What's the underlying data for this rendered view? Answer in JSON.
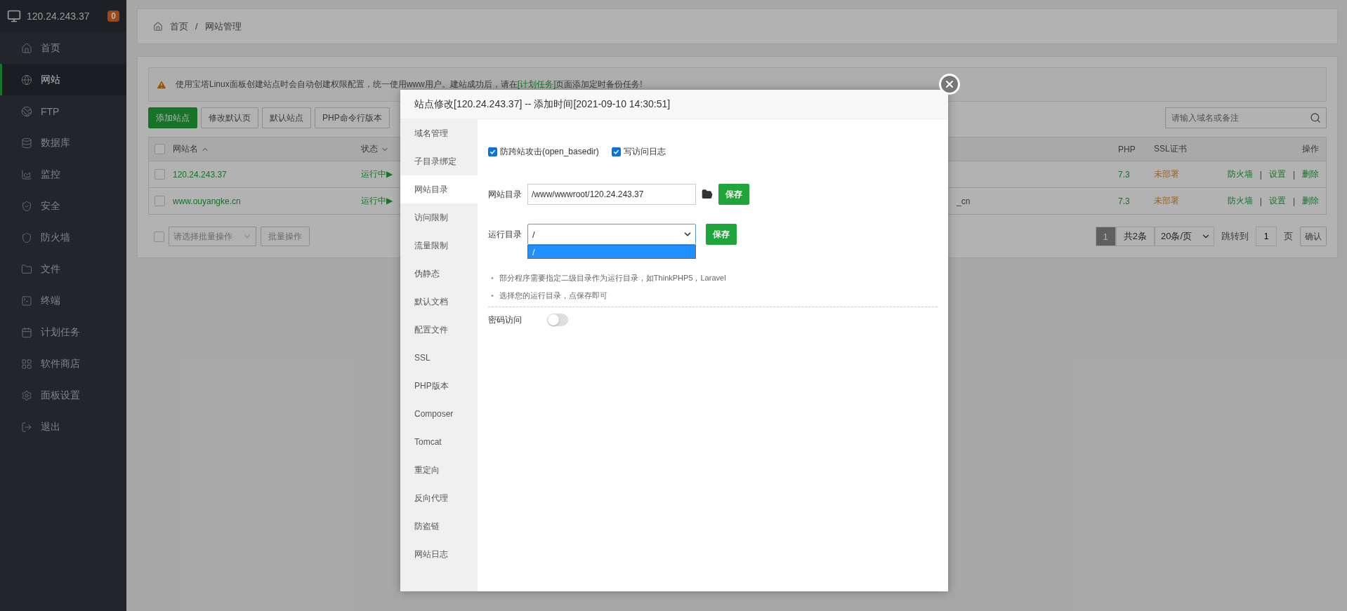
{
  "sidebar": {
    "host": "120.24.243.37",
    "badge": "0",
    "items": [
      {
        "kind": "home",
        "label": "首页",
        "selected": false
      },
      {
        "kind": "globe",
        "label": "网站",
        "selected": true
      },
      {
        "kind": "ftp",
        "label": "FTP",
        "selected": false
      },
      {
        "kind": "database",
        "label": "数据库",
        "selected": false
      },
      {
        "kind": "monitor",
        "label": "监控",
        "selected": false
      },
      {
        "kind": "security",
        "label": "安全",
        "selected": false
      },
      {
        "kind": "firewall",
        "label": "防火墙",
        "selected": false
      },
      {
        "kind": "files",
        "label": "文件",
        "selected": false
      },
      {
        "kind": "terminal",
        "label": "终端",
        "selected": false
      },
      {
        "kind": "calendar",
        "label": "计划任务",
        "selected": false
      },
      {
        "kind": "store",
        "label": "软件商店",
        "selected": false
      },
      {
        "kind": "settings",
        "label": "面板设置",
        "selected": false
      },
      {
        "kind": "logout",
        "label": "退出",
        "selected": false
      }
    ]
  },
  "breadcrumb": {
    "items": [
      "首页",
      "网站管理"
    ],
    "separator": "/"
  },
  "notice": {
    "before": "使用宝塔Linux面板创建站点时会自动创建权限配置，统一使用www用户。建站成功后，请在",
    "link": "[计划任务]",
    "after": "页面添加定时备份任务!"
  },
  "toolbar": {
    "buttons": [
      {
        "label": "添加站点",
        "primary": true
      },
      {
        "label": "修改默认页",
        "primary": false
      },
      {
        "label": "默认站点",
        "primary": false
      },
      {
        "label": "PHP命令行版本",
        "primary": false
      }
    ],
    "search": {
      "placeholder": "请输入域名或备注"
    }
  },
  "table": {
    "select_all": {
      "checked": false
    },
    "columns": [
      "网站名",
      "状态",
      "PHP",
      "SSL证书",
      "操作"
    ],
    "rows": [
      {
        "checked": false,
        "name": "120.24.243.37",
        "status": "运行中▶",
        "php": "7.3",
        "ssl": "未部署",
        "actions": [
          "防火墙",
          "设置",
          "删除"
        ],
        "separator": "|"
      },
      {
        "checked": false,
        "name": "www.ouyangke.cn",
        "status": "运行中▶",
        "note": "_cn",
        "php": "7.3",
        "ssl": "未部署",
        "actions": [
          "防火墙",
          "设置",
          "删除"
        ],
        "separator": "|"
      }
    ]
  },
  "batch": {
    "checked": false,
    "placeholder": "请选择批量操作",
    "button": "批量操作"
  },
  "pagination": {
    "current": "1",
    "total": "共2条",
    "per_page": "20条/页",
    "jump_label": "跳转到",
    "jump_value": "1",
    "page_unit": "页",
    "confirm": "确认"
  },
  "modal": {
    "title": "站点修改[120.24.243.37] -- 添加时间[2021-09-10 14:30:51]",
    "menu": [
      {
        "label": "域名管理",
        "selected": false
      },
      {
        "label": "子目录绑定",
        "selected": false
      },
      {
        "label": "网站目录",
        "selected": true
      },
      {
        "label": "访问限制",
        "selected": false
      },
      {
        "label": "流量限制",
        "selected": false
      },
      {
        "label": "伪静态",
        "selected": false
      },
      {
        "label": "默认文档",
        "selected": false
      },
      {
        "label": "配置文件",
        "selected": false
      },
      {
        "label": "SSL",
        "selected": false
      },
      {
        "label": "PHP版本",
        "selected": false
      },
      {
        "label": "Composer",
        "selected": false
      },
      {
        "label": "Tomcat",
        "selected": false
      },
      {
        "label": "重定向",
        "selected": false
      },
      {
        "label": "反向代理",
        "selected": false
      },
      {
        "label": "防盗链",
        "selected": false
      },
      {
        "label": "网站日志",
        "selected": false
      }
    ],
    "options": [
      {
        "label": "防跨站攻击(open_basedir)",
        "checked": true
      },
      {
        "label": "写访问日志",
        "checked": true
      }
    ],
    "site_dir": {
      "label": "网站目录",
      "value": "/www/wwwroot/120.24.243.37",
      "save": "保存"
    },
    "run_dir": {
      "label": "运行目录",
      "value": "/",
      "save": "保存",
      "options": [
        {
          "label": "/",
          "selected": true
        }
      ]
    },
    "tip_marker": "•",
    "tips": [
      "部分程序需要指定二级目录作为运行目录，如ThinkPHP5，Laravel",
      "选择您的运行目录，点保存即可"
    ],
    "password": {
      "label": "密码访问",
      "on": false
    }
  }
}
